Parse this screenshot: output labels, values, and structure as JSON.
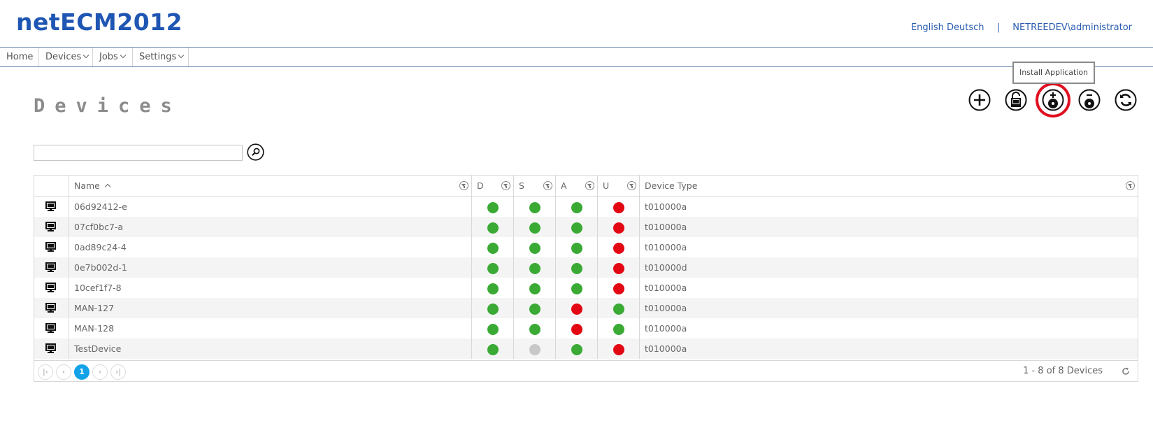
{
  "app": {
    "title": "netECM2012"
  },
  "top_links": {
    "lang_en": "English",
    "lang_de": "Deutsch",
    "separator": "|",
    "user": "NETREEDEV\\administrator"
  },
  "nav": [
    {
      "label": "Home",
      "dropdown": false
    },
    {
      "label": "Devices",
      "dropdown": true
    },
    {
      "label": "Jobs",
      "dropdown": true
    },
    {
      "label": "Settings",
      "dropdown": true
    }
  ],
  "page": {
    "title": "Devices"
  },
  "toolbar": {
    "actions": [
      {
        "name": "add-device",
        "icon": "plus-circle-icon"
      },
      {
        "name": "unlock-device",
        "icon": "unlock-device-icon"
      },
      {
        "name": "install-application",
        "icon": "install-disc-icon",
        "highlighted": true
      },
      {
        "name": "uninstall-application",
        "icon": "uninstall-disc-icon"
      },
      {
        "name": "refresh",
        "icon": "refresh-icon"
      }
    ],
    "tooltip": "Install Application"
  },
  "search": {
    "value": "",
    "placeholder": ""
  },
  "table": {
    "columns": [
      {
        "key": "icon",
        "label": ""
      },
      {
        "key": "name",
        "label": "Name",
        "sort": "asc"
      },
      {
        "key": "D",
        "label": "D"
      },
      {
        "key": "S",
        "label": "S"
      },
      {
        "key": "A",
        "label": "A"
      },
      {
        "key": "U",
        "label": "U"
      },
      {
        "key": "type",
        "label": "Device Type"
      }
    ],
    "status_colors": {
      "green": "#3aaa35",
      "red": "#e30613",
      "gray": "#c8c8c8"
    },
    "rows": [
      {
        "name": "06d92412-e",
        "D": "green",
        "S": "green",
        "A": "green",
        "U": "red",
        "type": "t010000a"
      },
      {
        "name": "07cf0bc7-a",
        "D": "green",
        "S": "green",
        "A": "green",
        "U": "red",
        "type": "t010000a"
      },
      {
        "name": "0ad89c24-4",
        "D": "green",
        "S": "green",
        "A": "green",
        "U": "red",
        "type": "t010000a"
      },
      {
        "name": "0e7b002d-1",
        "D": "green",
        "S": "green",
        "A": "green",
        "U": "red",
        "type": "t010000d"
      },
      {
        "name": "10cef1f7-8",
        "D": "green",
        "S": "green",
        "A": "green",
        "U": "red",
        "type": "t010000a"
      },
      {
        "name": "MAN-127",
        "D": "green",
        "S": "green",
        "A": "red",
        "U": "green",
        "type": "t010000a"
      },
      {
        "name": "MAN-128",
        "D": "green",
        "S": "green",
        "A": "red",
        "U": "green",
        "type": "t010000a"
      },
      {
        "name": "TestDevice",
        "D": "green",
        "S": "gray",
        "A": "green",
        "U": "red",
        "type": "t010000a"
      }
    ]
  },
  "pager": {
    "current_page": "1",
    "info": "1 - 8 of 8 Devices"
  },
  "colors": {
    "brand": "#1f56b4",
    "link": "#2a5db0",
    "active_page": "#13a2e8",
    "highlight": "#e01020"
  }
}
